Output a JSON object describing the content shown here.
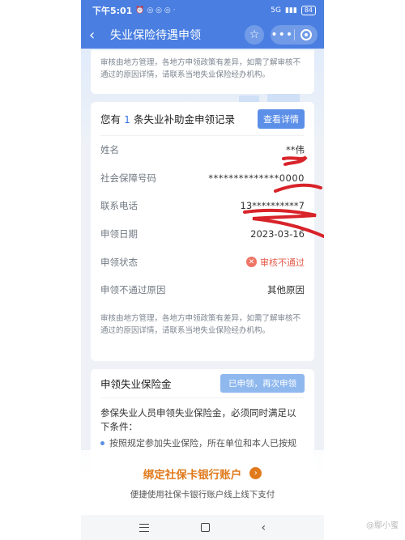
{
  "status_bar": {
    "time": "下午5:01",
    "indicators": "⏰ ◎ ◎ ◎ ·",
    "network": "5G",
    "battery": "84"
  },
  "header": {
    "back_icon": "chevron-left-icon",
    "title": "失业保险待遇申领",
    "star_icon": "star-outline-icon",
    "more_icon": "more-dots-icon",
    "close_icon": "target-close-icon"
  },
  "notice_top": "审核由地方管理，各地方申领政策有差异，如需了解审核不通过的原因详情，请联系当地失业保险经办机构。",
  "record": {
    "title_prefix": "您有",
    "count": "1",
    "title_suffix": "条失业补助金申领记录",
    "detail_button": "查看详情",
    "rows": [
      {
        "label": "姓名",
        "value": "**伟"
      },
      {
        "label": "社会保障号码",
        "value": "**************0000"
      },
      {
        "label": "联系电话",
        "value": "13**********7"
      },
      {
        "label": "申领日期",
        "value": "2023-03-16"
      },
      {
        "label": "申领状态",
        "value": "审核不通过"
      },
      {
        "label": "申领不通过原因",
        "value": "其他原因"
      }
    ],
    "status_color": "#e45b4b",
    "note": "审核由地方管理，各地方申领政策有差异，如需了解审核不通过的原因详情，请联系当地失业保险经办机构。"
  },
  "apply": {
    "title": "申领失业保险金",
    "button": "已申领，再次申领",
    "body": "参保失业人员申领失业保险金，必须同时满足以下条件：",
    "item1": "按照规定参加失业保险，所在单位和本人已按规"
  },
  "banner": {
    "title": "绑定社保卡银行账户",
    "subtitle": "便捷使用社保卡银行账户线上线下支付",
    "accent": "#e07a1c"
  },
  "watermark": "@鄢小蜜",
  "colors": {
    "primary": "#4a7fe1",
    "button": "#5b8fe8",
    "scribble": "#d8232a"
  }
}
